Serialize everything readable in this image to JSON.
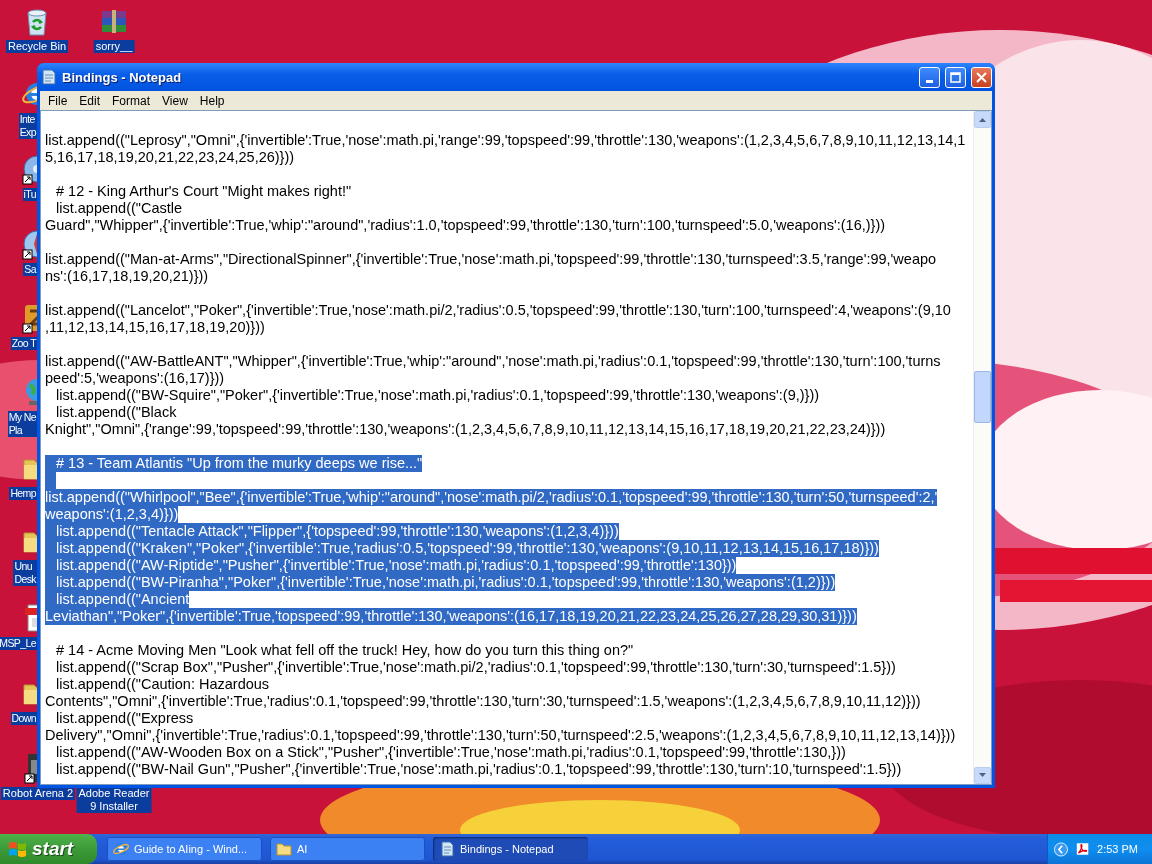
{
  "desktop": {
    "icons": [
      {
        "label": "Recycle Bin",
        "kind": "recycle"
      },
      {
        "label": "sorry__",
        "kind": "archive"
      },
      {
        "label": "Inte\nExp",
        "kind": "browser"
      },
      {
        "label": "iTu",
        "kind": "disc"
      },
      {
        "label": "Sa",
        "kind": "compass"
      },
      {
        "label": "Zoo T",
        "kind": "game"
      },
      {
        "label": "My Ne\nPla",
        "kind": "globe"
      },
      {
        "label": "Hemp",
        "kind": "folder"
      },
      {
        "label": "Unu\nDesk",
        "kind": "folder"
      },
      {
        "label": "MSP_Le",
        "kind": "pdf"
      },
      {
        "label": "Down",
        "kind": "folder"
      },
      {
        "label": "Robot Arena 2",
        "kind": "robot"
      },
      {
        "label": "Adobe Reader\n9 Installer",
        "kind": "hidden"
      }
    ]
  },
  "window": {
    "title": "Bindings - Notepad",
    "menu": [
      "File",
      "Edit",
      "Format",
      "View",
      "Help"
    ],
    "lines": [
      {
        "kind": "blank",
        "selected": false
      },
      {
        "kind": "text",
        "indented": false,
        "selected": false,
        "text": "list.append((\"Leprosy\",\"Omni\",{'invertible':True,'nose':math.pi,'range':99,'topspeed':99,'throttle':130,'weapons':(1,2,3,4,5,6,7,8,9,10,11,12,13,14,1"
      },
      {
        "kind": "text",
        "indented": false,
        "selected": false,
        "text": "5,16,17,18,19,20,21,22,23,24,25,26)}))"
      },
      {
        "kind": "blank",
        "selected": false
      },
      {
        "kind": "text",
        "indented": true,
        "selected": false,
        "text": "# 12 - King Arthur's Court \"Might makes right!\""
      },
      {
        "kind": "text",
        "indented": true,
        "selected": false,
        "text": "list.append((\"Castle"
      },
      {
        "kind": "text",
        "indented": false,
        "selected": false,
        "text": "Guard\",\"Whipper\",{'invertible':True,'whip':\"around\",'radius':1.0,'topspeed':99,'throttle':130,'turn':100,'turnspeed':5.0,'weapons':(16,)}))"
      },
      {
        "kind": "blank",
        "selected": false
      },
      {
        "kind": "text",
        "indented": false,
        "selected": false,
        "text": "list.append((\"Man-at-Arms\",\"DirectionalSpinner\",{'invertible':True,'nose':math.pi,'topspeed':99,'throttle':130,'turnspeed':3.5,'range':99,'weapo"
      },
      {
        "kind": "text",
        "indented": false,
        "selected": false,
        "text": "ns':(16,17,18,19,20,21)}))"
      },
      {
        "kind": "blank",
        "selected": false
      },
      {
        "kind": "text",
        "indented": false,
        "selected": false,
        "text": "list.append((\"Lancelot\",\"Poker\",{'invertible':True,'nose':math.pi/2,'radius':0.5,'topspeed':99,'throttle':130,'turn':100,'turnspeed':4,'weapons':(9,10"
      },
      {
        "kind": "text",
        "indented": false,
        "selected": false,
        "text": ",11,12,13,14,15,16,17,18,19,20)}))"
      },
      {
        "kind": "blank",
        "selected": false
      },
      {
        "kind": "text",
        "indented": false,
        "selected": false,
        "text": "list.append((\"AW-BattleANT\",\"Whipper\",{'invertible':True,'whip':\"around\",'nose':math.pi,'radius':0.1,'topspeed':99,'throttle':130,'turn':100,'turns"
      },
      {
        "kind": "text",
        "indented": false,
        "selected": false,
        "text": "peed':5,'weapons':(16,17)}))"
      },
      {
        "kind": "text",
        "indented": true,
        "selected": false,
        "text": "list.append((\"BW-Squire\",\"Poker\",{'invertible':True,'nose':math.pi,'radius':0.1,'topspeed':99,'throttle':130,'weapons':(9,)}))"
      },
      {
        "kind": "text",
        "indented": true,
        "selected": false,
        "text": "list.append((\"Black"
      },
      {
        "kind": "text",
        "indented": false,
        "selected": false,
        "text": "Knight\",\"Omni\",{'range':99,'topspeed':99,'throttle':130,'weapons':(1,2,3,4,5,6,7,8,9,10,11,12,13,14,15,16,17,18,19,20,21,22,23,24)}))"
      },
      {
        "kind": "blank",
        "selected": false
      },
      {
        "kind": "text",
        "indented": true,
        "selected": true,
        "text": "# 13 - Team Atlantis \"Up from the murky deeps we rise...\""
      },
      {
        "kind": "blank",
        "selected": true
      },
      {
        "kind": "text",
        "indented": false,
        "selected": true,
        "text": "list.append((\"Whirlpool\",\"Bee\",{'invertible':True,'whip':\"around\",'nose':math.pi/2,'radius':0.1,'topspeed':99,'throttle':130,'turn':50,'turnspeed':2,'"
      },
      {
        "kind": "text",
        "indented": false,
        "selected": true,
        "text": "weapons':(1,2,3,4)}))"
      },
      {
        "kind": "text",
        "indented": true,
        "selected": true,
        "text": "list.append((\"Tentacle Attack\",\"Flipper\",{'topspeed':99,'throttle':130,'weapons':(1,2,3,4)}))"
      },
      {
        "kind": "text",
        "indented": true,
        "selected": true,
        "text": "list.append((\"Kraken\",\"Poker\",{'invertible':True,'radius':0.5,'topspeed':99,'throttle':130,'weapons':(9,10,11,12,13,14,15,16,17,18)}))"
      },
      {
        "kind": "text",
        "indented": true,
        "selected": true,
        "text": "list.append((\"AW-Riptide\",\"Pusher\",{'invertible':True,'nose':math.pi,'radius':0.1,'topspeed':99,'throttle':130}))"
      },
      {
        "kind": "text",
        "indented": true,
        "selected": true,
        "text": "list.append((\"BW-Piranha\",\"Poker\",{'invertible':True,'nose':math.pi,'radius':0.1,'topspeed':99,'throttle':130,'weapons':(1,2)}))"
      },
      {
        "kind": "text",
        "indented": true,
        "selected": true,
        "text": "list.append((\"Ancient"
      },
      {
        "kind": "text",
        "indented": false,
        "selected": true,
        "text": "Leviathan\",\"Poker\",{'invertible':True,'topspeed':99,'throttle':130,'weapons':(16,17,18,19,20,21,22,23,24,25,26,27,28,29,30,31)}))"
      },
      {
        "kind": "blank",
        "selected": false
      },
      {
        "kind": "text",
        "indented": true,
        "selected": false,
        "text": "# 14 - Acme Moving Men \"Look what fell off the truck! Hey, how do you turn this thing on?\""
      },
      {
        "kind": "text",
        "indented": true,
        "selected": false,
        "text": "list.append((\"Scrap Box\",\"Pusher\",{'invertible':True,'nose':math.pi/2,'radius':0.1,'topspeed':99,'throttle':130,'turn':30,'turnspeed':1.5}))"
      },
      {
        "kind": "text",
        "indented": true,
        "selected": false,
        "text": "list.append((\"Caution: Hazardous"
      },
      {
        "kind": "text",
        "indented": false,
        "selected": false,
        "text": "Contents\",\"Omni\",{'invertible':True,'radius':0.1,'topspeed':99,'throttle':130,'turn':30,'turnspeed':1.5,'weapons':(1,2,3,4,5,6,7,8,9,10,11,12)}))"
      },
      {
        "kind": "text",
        "indented": true,
        "selected": false,
        "text": "list.append((\"Express"
      },
      {
        "kind": "text",
        "indented": false,
        "selected": false,
        "text": "Delivery\",\"Omni\",{'invertible':True,'radius':0.1,'topspeed':99,'throttle':130,'turn':50,'turnspeed':2.5,'weapons':(1,2,3,4,5,6,7,8,9,10,11,12,13,14)}))"
      },
      {
        "kind": "text",
        "indented": true,
        "selected": false,
        "text": "list.append((\"AW-Wooden Box on a Stick\",\"Pusher\",{'invertible':True,'nose':math.pi,'radius':0.1,'topspeed':99,'throttle':130,}))"
      },
      {
        "kind": "text",
        "indented": true,
        "selected": false,
        "text": "list.append((\"BW-Nail Gun\",\"Pusher\",{'invertible':True,'nose':math.pi,'radius':0.1,'topspeed':99,'throttle':130,'turn':10,'turnspeed':1.5}))"
      }
    ]
  },
  "taskbar": {
    "start": "start",
    "tasks": [
      {
        "label": "Guide to AIing - Wind...",
        "kind": "browser",
        "selected": false
      },
      {
        "label": "AI",
        "kind": "folder",
        "selected": false
      },
      {
        "label": "Bindings - Notepad",
        "kind": "notepad",
        "selected": true
      }
    ],
    "clock": "2:53 PM"
  }
}
